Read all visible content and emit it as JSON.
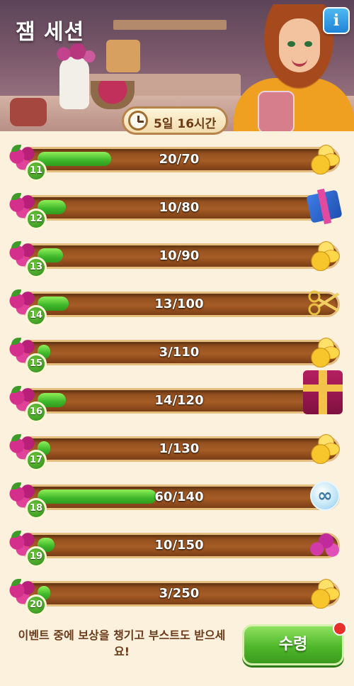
{
  "header": {
    "title": "잼 세션",
    "info_icon": "info-icon",
    "info_label": "i",
    "timer": "5일 16시간"
  },
  "rows": [
    {
      "level": "11",
      "progress": "20/70",
      "current": 20,
      "target": 70,
      "fill_fraction": 0.26,
      "reward": "coins-icon"
    },
    {
      "level": "12",
      "progress": "10/80",
      "current": 10,
      "target": 80,
      "fill_fraction": 0.1,
      "reward": "blue-gift-icon"
    },
    {
      "level": "13",
      "progress": "10/90",
      "current": 10,
      "target": 90,
      "fill_fraction": 0.09,
      "reward": "coins-icon"
    },
    {
      "level": "14",
      "progress": "13/100",
      "current": 13,
      "target": 100,
      "fill_fraction": 0.11,
      "reward": "scissors-icon"
    },
    {
      "level": "15",
      "progress": "3/110",
      "current": 3,
      "target": 110,
      "fill_fraction": 0.03,
      "reward": "coins-icon"
    },
    {
      "level": "16",
      "progress": "14/120",
      "current": 14,
      "target": 120,
      "fill_fraction": 0.1,
      "reward": "red-gift-icon"
    },
    {
      "level": "17",
      "progress": "1/130",
      "current": 1,
      "target": 130,
      "fill_fraction": 0.01,
      "reward": "coins-icon"
    },
    {
      "level": "18",
      "progress": "60/140",
      "current": 60,
      "target": 140,
      "fill_fraction": 0.42,
      "reward": "infinity-icon"
    },
    {
      "level": "19",
      "progress": "10/150",
      "current": 10,
      "target": 150,
      "fill_fraction": 0.06,
      "reward": "gems-icon"
    },
    {
      "level": "20",
      "progress": "3/250",
      "current": 3,
      "target": 250,
      "fill_fraction": 0.01,
      "reward": "coins-icon"
    }
  ],
  "footer": {
    "message": "이벤트 중에 보상을 챙기고 부스트도 받으세요!",
    "claim_label": "수령"
  },
  "colors": {
    "progress_fill": "#3fb82a",
    "track": "#a65c26",
    "claim_button": "#4fb82a",
    "info_button": "#1f84d6"
  }
}
